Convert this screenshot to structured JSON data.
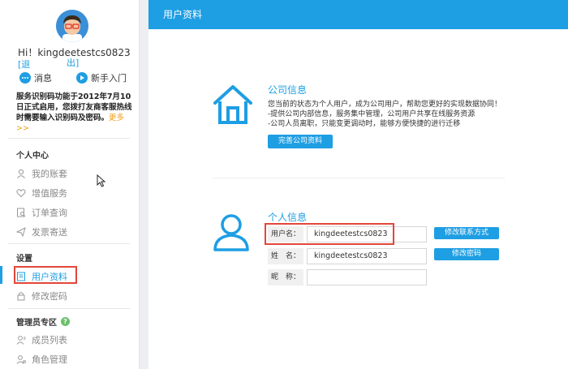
{
  "user": {
    "greeting": "Hi！kingdeetestcs0823",
    "logout_part1": "[退",
    "logout_part2": "出]"
  },
  "quick_links": {
    "messages": "消息",
    "newbie": "新手入门"
  },
  "notice": {
    "text": "服务识别码功能于2012年7月10日正式启用，您拨打友商客服热线时需要输入识别码及密码。",
    "more": "更多>>"
  },
  "sidebar": {
    "personal_center": {
      "title": "个人中心",
      "items": [
        "我的账套",
        "增值服务",
        "订单查询",
        "发票寄送"
      ]
    },
    "settings": {
      "title": "设置",
      "items": [
        "用户资料",
        "修改密码"
      ]
    },
    "admin": {
      "title": "管理员专区",
      "help": "?",
      "items": [
        "成员列表",
        "角色管理"
      ]
    }
  },
  "main": {
    "header": "用户资料",
    "company": {
      "title": "公司信息",
      "lines": [
        "您当前的状态为个人用户，成为公司用户，帮助您更好的实现数据协同！",
        "-提供公司内部信息，服务集中管理，公司用户共享在线服务资源",
        "-公司人员离职，只能变更调动时，能够方便快捷的进行迁移"
      ],
      "button": "完善公司资料"
    },
    "personal": {
      "title": "个人信息",
      "fields": [
        {
          "label": "用户名：",
          "value": "kingdeetestcs0823"
        },
        {
          "label": "姓　名：",
          "value": "kingdeetestcs0823"
        },
        {
          "label": "昵　称：",
          "value": ""
        }
      ],
      "btn_contact": "修改联系方式",
      "btn_password": "修改密码"
    }
  },
  "colors": {
    "accent": "#1e9ee3",
    "highlight": "#e2473a"
  }
}
